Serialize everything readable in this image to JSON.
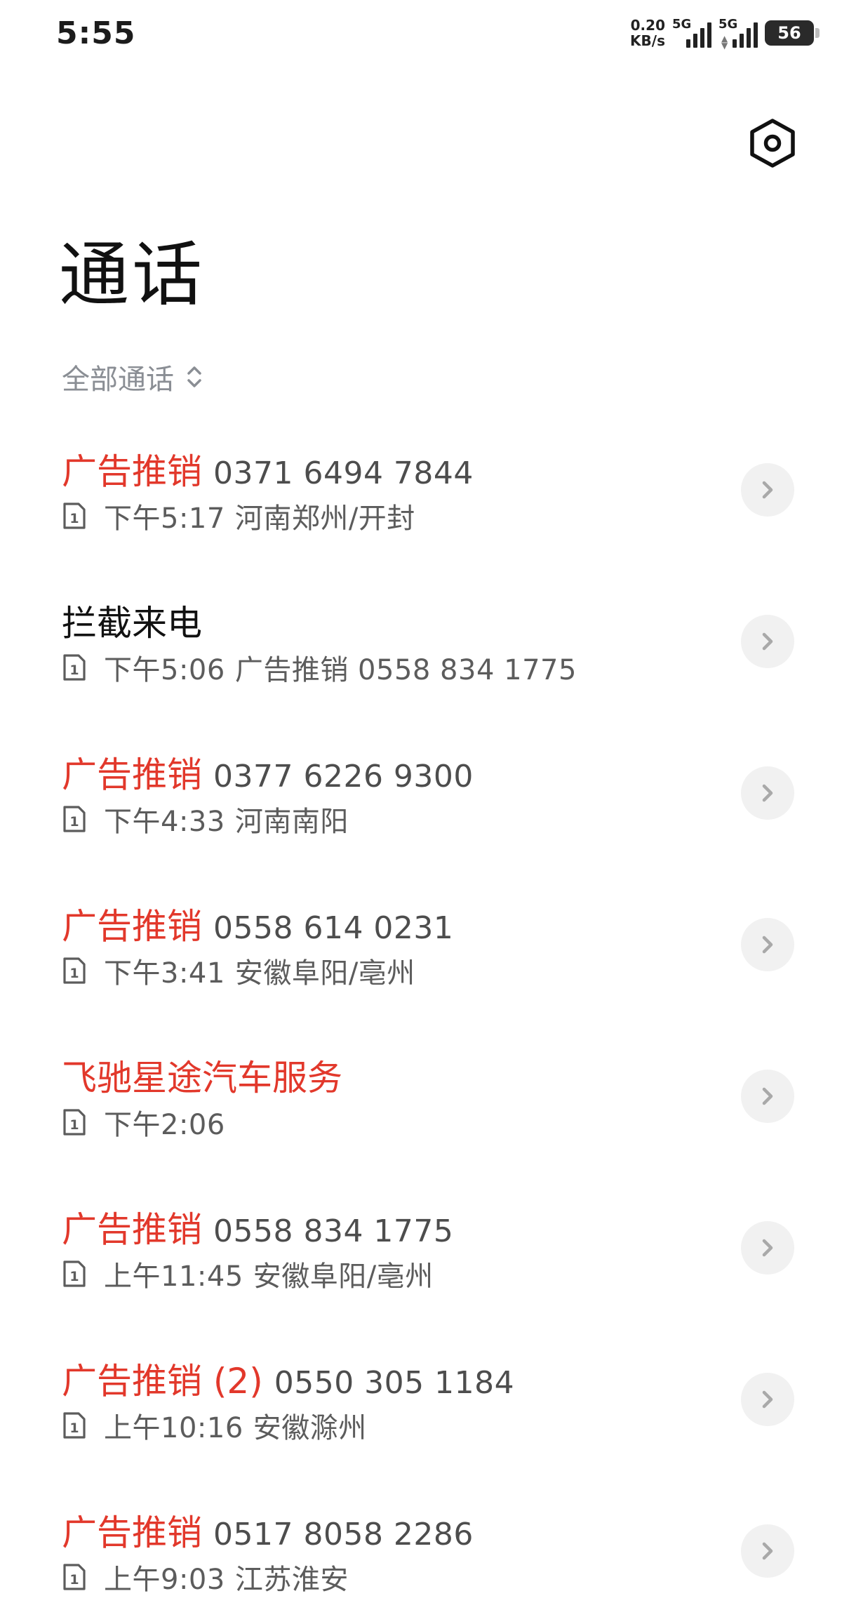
{
  "status_bar": {
    "time": "5:55",
    "speed_value": "0.20",
    "speed_unit": "KB/s",
    "sim1_network": "5G",
    "sim2_network": "5G",
    "battery": "56"
  },
  "header": {
    "title": "通话",
    "settings_icon": "settings-hexagon-icon"
  },
  "filter": {
    "label": "全部通话",
    "icon": "chevron-up-down-icon"
  },
  "colors": {
    "spam_red": "#e2382b",
    "text_primary": "#111111",
    "text_secondary": "#5c5c5c",
    "filter_gray": "#8a8e94",
    "button_bg": "#f1f1f1"
  },
  "calls": [
    {
      "name": "广告推销",
      "number": "0371 6494 7844",
      "time": "下午5:17",
      "info": "河南郑州/开封",
      "flagged": true,
      "sim": "1"
    },
    {
      "name": "拦截来电",
      "number": "",
      "time": "下午5:06",
      "info": "广告推销 0558 834 1775",
      "flagged": false,
      "sim": "1"
    },
    {
      "name": "广告推销",
      "number": "0377 6226 9300",
      "time": "下午4:33",
      "info": "河南南阳",
      "flagged": true,
      "sim": "1"
    },
    {
      "name": "广告推销",
      "number": "0558 614 0231",
      "time": "下午3:41",
      "info": "安徽阜阳/亳州",
      "flagged": true,
      "sim": "1"
    },
    {
      "name": "飞驰星途汽车服务",
      "number": "",
      "time": "下午2:06",
      "info": "",
      "flagged": true,
      "sim": "1"
    },
    {
      "name": "广告推销",
      "number": "0558 834 1775",
      "time": "上午11:45",
      "info": "安徽阜阳/亳州",
      "flagged": true,
      "sim": "1"
    },
    {
      "name": "广告推销 (2)",
      "number": "0550 305 1184",
      "time": "上午10:16",
      "info": "安徽滁州",
      "flagged": true,
      "sim": "1"
    },
    {
      "name": "广告推销",
      "number": "0517 8058 2286",
      "time": "上午9:03",
      "info": "江苏淮安",
      "flagged": true,
      "sim": "1"
    }
  ]
}
